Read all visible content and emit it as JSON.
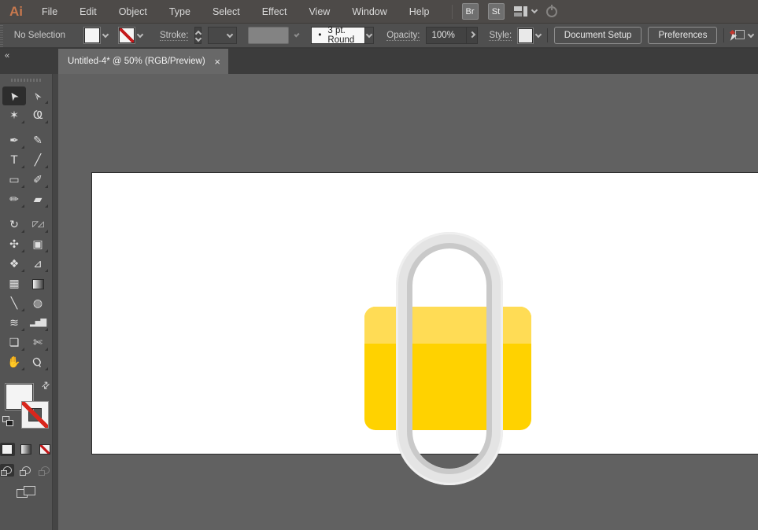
{
  "menu_bar": {
    "logo": "Ai",
    "items": [
      "File",
      "Edit",
      "Object",
      "Type",
      "Select",
      "Effect",
      "View",
      "Window",
      "Help"
    ],
    "bridge_label": "Br",
    "stock_label": "St"
  },
  "control_bar": {
    "selection_status": "No Selection",
    "stroke_label": "Stroke:",
    "brush_dot": "•",
    "brush_value": "3 pt. Round",
    "opacity_label": "Opacity:",
    "opacity_value": "100%",
    "style_label": "Style:",
    "document_setup_label": "Document Setup",
    "preferences_label": "Preferences"
  },
  "document_tab": {
    "title": "Untitled-4* @ 50% (RGB/Preview)",
    "close_glyph": "×"
  },
  "toolbar": {
    "collapse_glyph": "«",
    "swap_glyph": "⇄",
    "tools": [
      {
        "id": "selection",
        "name": "Selection Tool",
        "glyph": "➤",
        "selected": true,
        "flyout": false
      },
      {
        "id": "direct-selection",
        "name": "Direct Selection Tool",
        "glyph": "➢",
        "flyout": true
      },
      {
        "id": "magic-wand",
        "name": "Magic Wand Tool",
        "glyph": "✶",
        "flyout": true
      },
      {
        "id": "lasso",
        "name": "Lasso Tool",
        "glyph": "Ҩ",
        "flyout": true
      },
      {
        "id": "pen",
        "name": "Pen Tool",
        "glyph": "✒",
        "flyout": true
      },
      {
        "id": "curvature",
        "name": "Curvature Tool",
        "glyph": "✎",
        "flyout": false
      },
      {
        "id": "type",
        "name": "Type Tool",
        "glyph": "T",
        "flyout": true
      },
      {
        "id": "line-segment",
        "name": "Line Segment Tool",
        "glyph": "╱",
        "flyout": true
      },
      {
        "id": "rectangle",
        "name": "Rectangle Tool",
        "glyph": "▭",
        "flyout": true
      },
      {
        "id": "paintbrush",
        "name": "Paintbrush Tool",
        "glyph": "✐",
        "flyout": true
      },
      {
        "id": "shaper",
        "name": "Shaper Tool",
        "glyph": "✏",
        "flyout": true
      },
      {
        "id": "eraser",
        "name": "Eraser Tool",
        "glyph": "▰",
        "flyout": true
      },
      {
        "id": "rotate",
        "name": "Rotate Tool",
        "glyph": "↻",
        "flyout": true
      },
      {
        "id": "scale",
        "name": "Scale Tool",
        "glyph": "◸◿",
        "small": true,
        "flyout": true
      },
      {
        "id": "width",
        "name": "Width Tool",
        "glyph": "✣",
        "flyout": true
      },
      {
        "id": "free-transform",
        "name": "Free Transform Tool",
        "glyph": "▣",
        "flyout": true
      },
      {
        "id": "shape-builder",
        "name": "Shape Builder Tool",
        "glyph": "❖",
        "flyout": true
      },
      {
        "id": "perspective-grid",
        "name": "Perspective Grid Tool",
        "glyph": "⊿",
        "flyout": true
      },
      {
        "id": "mesh",
        "name": "Mesh Tool",
        "glyph": "▦",
        "flyout": false
      },
      {
        "id": "gradient",
        "name": "Gradient Tool",
        "glyph": "",
        "swatch": "gradient",
        "flyout": false
      },
      {
        "id": "eyedropper",
        "name": "Eyedropper Tool",
        "glyph": "╲",
        "flyout": true
      },
      {
        "id": "blend",
        "name": "Blend Tool",
        "glyph": "◍",
        "flyout": false
      },
      {
        "id": "symbol-sprayer",
        "name": "Symbol Sprayer Tool",
        "glyph": "≋",
        "flyout": true
      },
      {
        "id": "column-graph",
        "name": "Column Graph Tool",
        "glyph": "▂▅▇",
        "small": true,
        "flyout": true
      },
      {
        "id": "artboard",
        "name": "Artboard Tool",
        "glyph": "❏",
        "flyout": true
      },
      {
        "id": "slice",
        "name": "Slice Tool",
        "glyph": "✄",
        "flyout": true
      },
      {
        "id": "hand",
        "name": "Hand Tool",
        "glyph": "✋",
        "flyout": true
      },
      {
        "id": "zoom",
        "name": "Zoom Tool",
        "glyph": "Ϙ",
        "flyout": true
      }
    ]
  },
  "canvas": {
    "pasteboard_color": "#616161",
    "artboard_color": "#FFFFFF",
    "lock_body_color": "#FFD200",
    "lock_band_color": "#FFDC55",
    "ring_color": "#E4E4E4",
    "ring_shadow_color": "#C9C9C9",
    "ring_highlight_color": "#EFEFEF"
  }
}
